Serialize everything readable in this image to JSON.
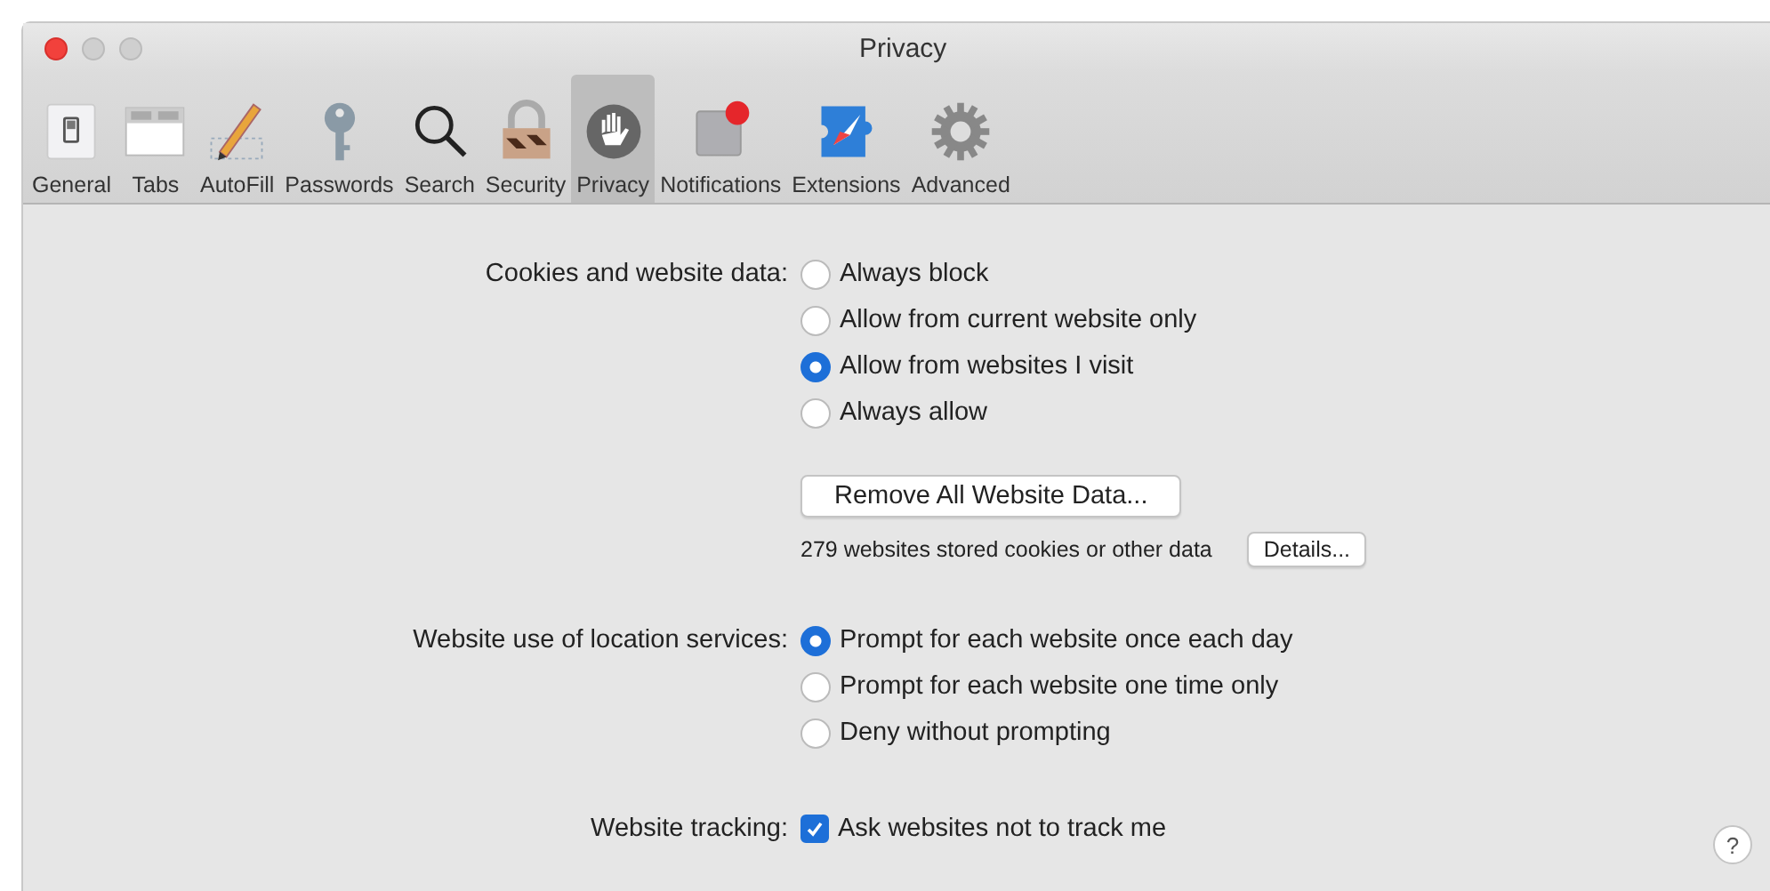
{
  "window": {
    "title": "Privacy"
  },
  "tabs": [
    {
      "label": "General",
      "selected": false
    },
    {
      "label": "Tabs",
      "selected": false
    },
    {
      "label": "AutoFill",
      "selected": false
    },
    {
      "label": "Passwords",
      "selected": false
    },
    {
      "label": "Search",
      "selected": false
    },
    {
      "label": "Security",
      "selected": false
    },
    {
      "label": "Privacy",
      "selected": true
    },
    {
      "label": "Notifications",
      "selected": false
    },
    {
      "label": "Extensions",
      "selected": false
    },
    {
      "label": "Advanced",
      "selected": false
    }
  ],
  "cookies": {
    "label": "Cookies and website data:",
    "options": [
      {
        "label": "Always block",
        "selected": false
      },
      {
        "label": "Allow from current website only",
        "selected": false
      },
      {
        "label": "Allow from websites I visit",
        "selected": true
      },
      {
        "label": "Always allow",
        "selected": false
      }
    ],
    "remove_button": "Remove All Website Data...",
    "stored_info": "279 websites stored cookies or other data",
    "details_button": "Details..."
  },
  "location": {
    "label": "Website use of location services:",
    "options": [
      {
        "label": "Prompt for each website once each day",
        "selected": true
      },
      {
        "label": "Prompt for each website one time only",
        "selected": false
      },
      {
        "label": "Deny without prompting",
        "selected": false
      }
    ]
  },
  "tracking": {
    "label": "Website tracking:",
    "checkbox": {
      "label": "Ask websites not to track me",
      "checked": true
    }
  },
  "help_button": "?"
}
